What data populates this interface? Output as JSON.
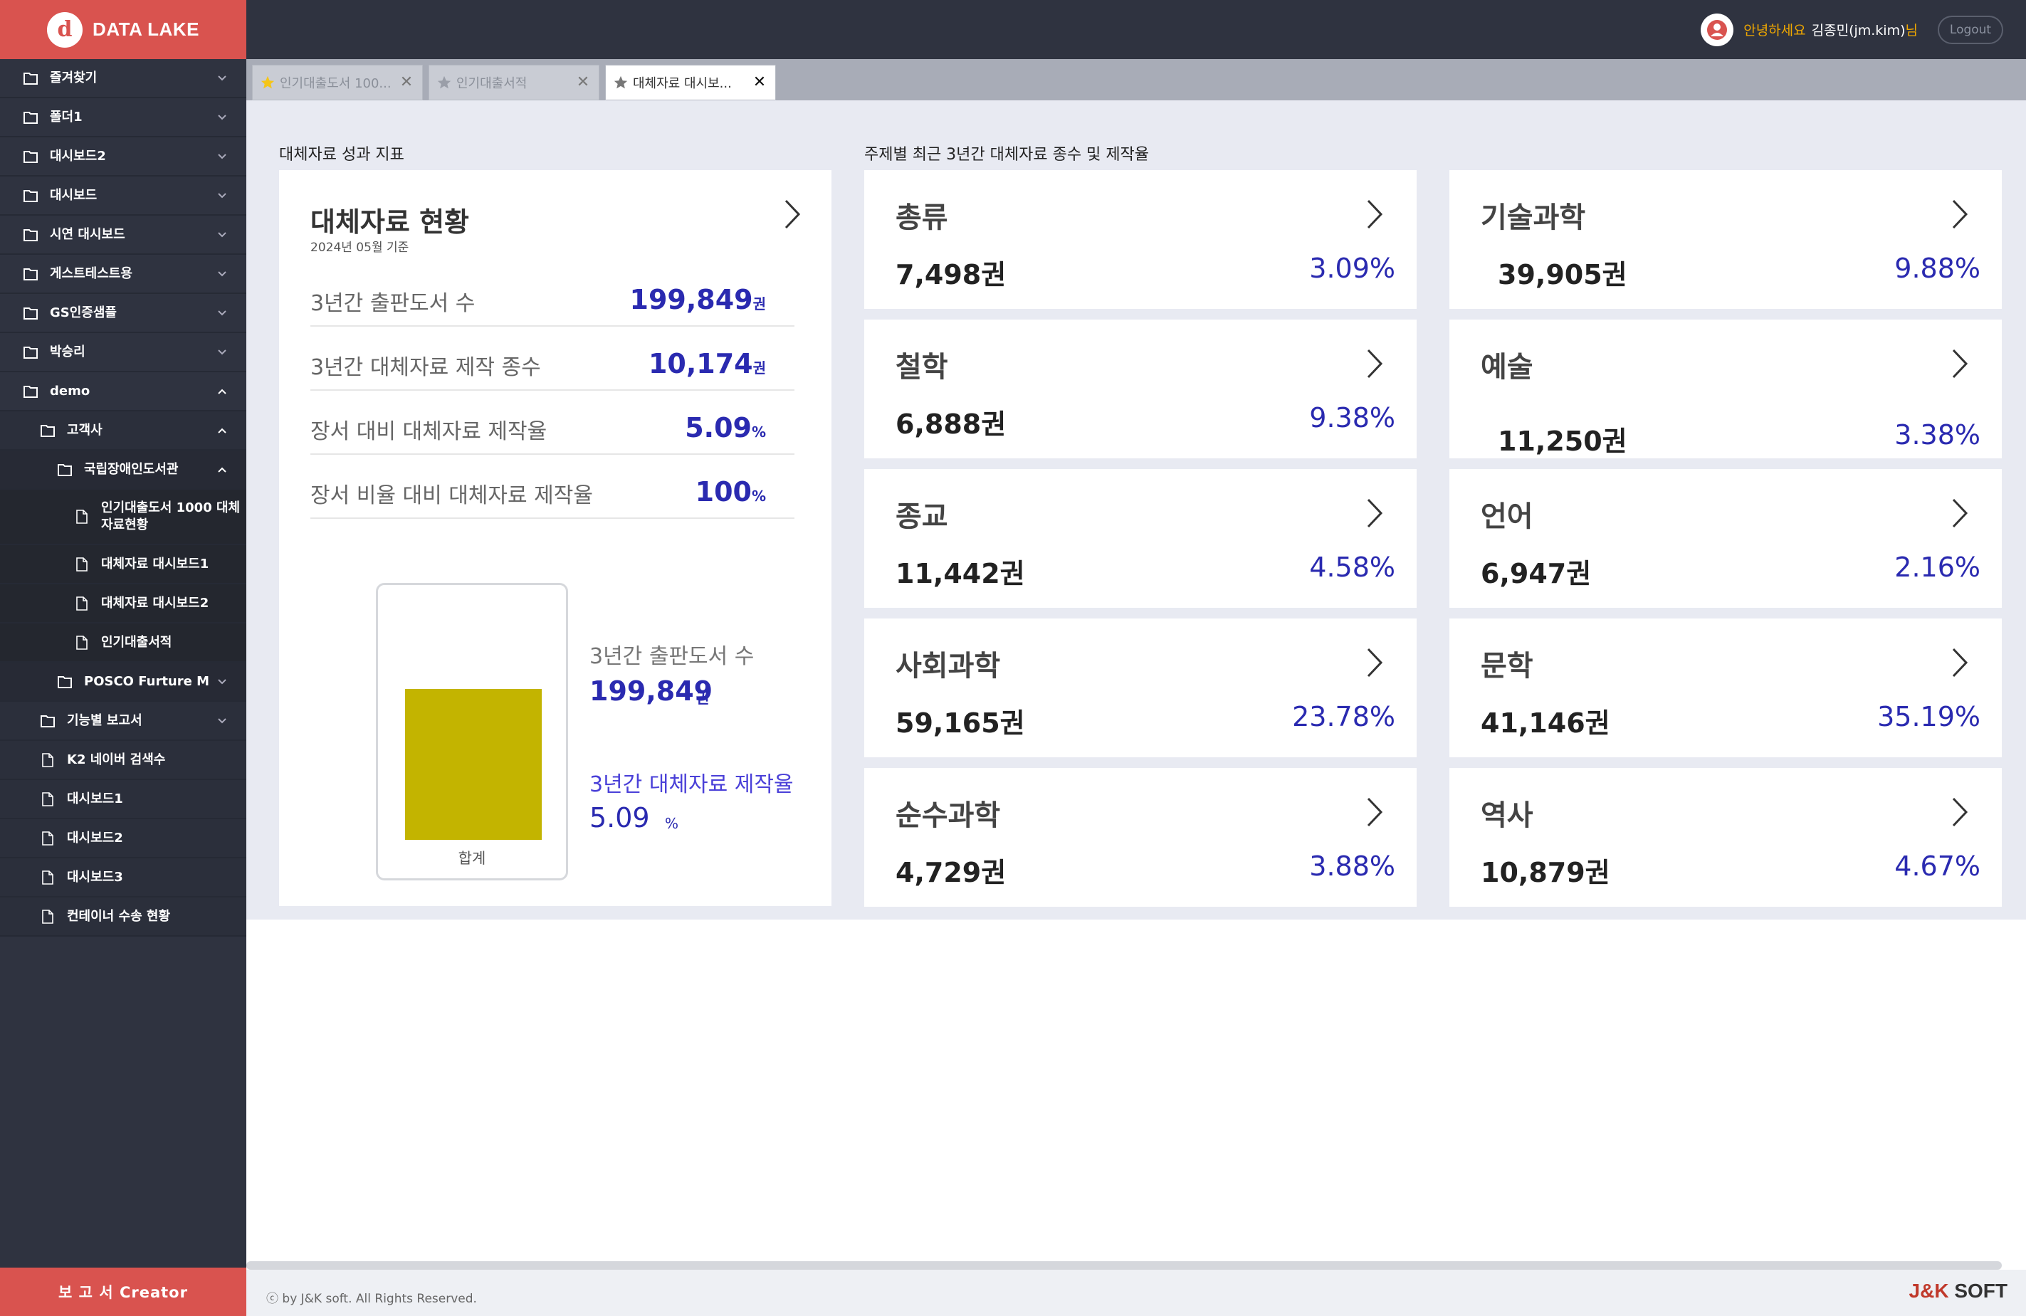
{
  "app": {
    "logo_text": "DATA LAKE",
    "logo_glyph": "d"
  },
  "header": {
    "greeting": "안녕하세요",
    "user_name": "김종민(jm.kim)",
    "user_suffix": "님",
    "logout_label": "Logout"
  },
  "sidebar": {
    "items": [
      {
        "label": "즐겨찾기",
        "icon": "folder-icon",
        "chevron": "down"
      },
      {
        "label": "폴더1",
        "icon": "folder-icon",
        "chevron": "down"
      },
      {
        "label": "대시보드2",
        "icon": "folder-icon",
        "chevron": "down"
      },
      {
        "label": "대시보드",
        "icon": "folder-icon",
        "chevron": "down"
      },
      {
        "label": "시연 대시보드",
        "icon": "folder-icon",
        "chevron": "down"
      },
      {
        "label": "게스트테스트용",
        "icon": "folder-icon",
        "chevron": "down"
      },
      {
        "label": "GS인증샘플",
        "icon": "folder-icon",
        "chevron": "down"
      },
      {
        "label": "박승리",
        "icon": "folder-icon",
        "chevron": "down"
      },
      {
        "label": "demo",
        "icon": "folder-icon",
        "chevron": "up"
      },
      {
        "label": "고객사",
        "icon": "folder-icon",
        "chevron": "up"
      },
      {
        "label": "국립장애인도서관",
        "icon": "folder-icon",
        "chevron": "up"
      },
      {
        "label": "인기대출도서 1000 대체자료현황",
        "icon": "file-icon"
      },
      {
        "label": "대체자료 대시보드1",
        "icon": "file-icon"
      },
      {
        "label": "대체자료 대시보드2",
        "icon": "file-icon"
      },
      {
        "label": "인기대출서적",
        "icon": "file-icon"
      },
      {
        "label": "POSCO Furture M",
        "icon": "folder-icon",
        "chevron": "down"
      },
      {
        "label": "기능별 보고서",
        "icon": "folder-icon",
        "chevron": "down"
      },
      {
        "label": "K2 네이버 검색수",
        "icon": "file-icon"
      },
      {
        "label": "대시보드1",
        "icon": "file-icon"
      },
      {
        "label": "대시보드2",
        "icon": "file-icon"
      },
      {
        "label": "대시보드3",
        "icon": "file-icon"
      },
      {
        "label": "컨테이너 수송 현황",
        "icon": "file-icon"
      }
    ],
    "creator_label": "보 고 서 Creator"
  },
  "tabs": [
    {
      "label": "인기대출도서 100...",
      "star": "filled",
      "active": false
    },
    {
      "label": "인기대출서적",
      "star": "outline",
      "active": false
    },
    {
      "label": "대체자료 대시보...",
      "star": "outline",
      "active": true
    }
  ],
  "dashboard": {
    "left_section_title": "대체자료 성과 지표",
    "right_section_title": "주제별 최근 3년간 대체자료 종수 및 제작율",
    "summary": {
      "title": "대체자료 현황",
      "date": "2024년 05월 기준",
      "rows": [
        {
          "label": "3년간 출판도서 수",
          "value": "199,849",
          "unit": "권"
        },
        {
          "label": "3년간 대체자료 제작 종수",
          "value": "10,174",
          "unit": "권"
        },
        {
          "label": "장서 대비 대체자료 제작율",
          "value": "5.09",
          "unit": "%"
        },
        {
          "label": "장서 비율 대비 대체자료 제작율",
          "value": "100",
          "unit": "%"
        }
      ],
      "chart": {
        "bar_label": "합계",
        "bar_color": "#c3b400",
        "bar_fill_fraction": 0.62,
        "legend1_label": "3년간 출판도서 수",
        "legend1_value": "199,849",
        "legend1_unit": "권",
        "legend2_label": "3년간 대체자료 제작율",
        "legend2_value": "5.09",
        "legend2_unit": "%"
      }
    },
    "subjects": [
      {
        "name": "총류",
        "count": "7,498권",
        "pct": "3.09%"
      },
      {
        "name": "기술과학",
        "count": "39,905권",
        "pct": "9.88%"
      },
      {
        "name": "철학",
        "count": "6,888권",
        "pct": "9.38%"
      },
      {
        "name": "예술",
        "count": "11,250권",
        "pct": "3.38%"
      },
      {
        "name": "종교",
        "count": "11,442권",
        "pct": "4.58%"
      },
      {
        "name": "언어",
        "count": "6,947권",
        "pct": "2.16%"
      },
      {
        "name": "사회과학",
        "count": "59,165권",
        "pct": "23.78%"
      },
      {
        "name": "문학",
        "count": "41,146권",
        "pct": "35.19%"
      },
      {
        "name": "순수과학",
        "count": "4,729권",
        "pct": "3.88%"
      },
      {
        "name": "역사",
        "count": "10,879권",
        "pct": "4.67%"
      }
    ]
  },
  "footer": {
    "copyright": "ⓒ by J&K soft. All Rights Reserved.",
    "brand_jk": "J&K",
    "brand_soft": " SOFT"
  },
  "colors": {
    "accent": "#d9534f",
    "sidebar": "#2f3340",
    "value_blue": "#2a2ab0",
    "greeting": "#f0a800"
  }
}
